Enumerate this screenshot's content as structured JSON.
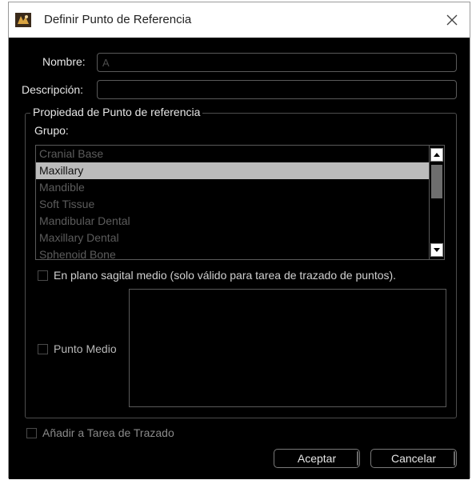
{
  "window": {
    "title": "Definir Punto de Referencia",
    "icons": {
      "app": "app-logo-icon",
      "close": "close-icon"
    }
  },
  "form": {
    "nombre_label": "Nombre:",
    "nombre_value": "A",
    "descripcion_label": "Descripción:",
    "descripcion_value": ""
  },
  "group": {
    "title": "Propiedad de Punto de referencia",
    "grupo_label": "Grupo:",
    "items": [
      "Cranial Base",
      "Maxillary",
      "Mandible",
      "Soft Tissue",
      "Mandibular Dental",
      "Maxillary Dental",
      "Sphenoid Bone"
    ],
    "selected_item": "Maxillary",
    "checkbox_sagital_label": "En plano sagital medio (solo válido para tarea de trazado de puntos).",
    "checkbox_sagital_checked": false,
    "checkbox_punto_medio_label": "Punto Medio",
    "checkbox_punto_medio_checked": false
  },
  "footer": {
    "checkbox_anadir_label": "Añadir a Tarea de Trazado",
    "checkbox_anadir_checked": false,
    "accept_label": "Aceptar",
    "cancel_label": "Cancelar"
  },
  "colors": {
    "background": "#000000",
    "titlebar": "#ffffff",
    "selection": "#bcbcbc",
    "text": "#e6e6e6",
    "disabled_text": "#5c5c5c"
  }
}
